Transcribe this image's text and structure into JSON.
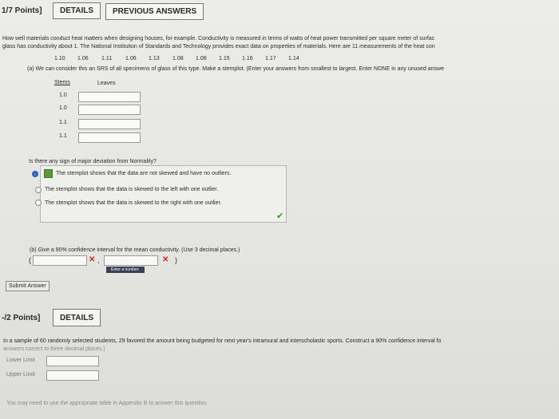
{
  "q1": {
    "points": "1/7 Points]",
    "details_button": "DETAILS",
    "previous_answers_button": "PREVIOUS ANSWERS",
    "intro_line1": "How well materials conduct heat matters when designing houses, for example. Conductivity is measured in terms of watts of heat power transmitted per square meter of surfac",
    "intro_line2": "glass has conductivity about 1. The National Institution of Standards and Technology provides exact data on properties of materials. Here are 11 measurements of the heat con",
    "measurements": [
      "1.10",
      "1.06",
      "1.11",
      "1.06",
      "1.13",
      "1.08",
      "1.08",
      "1.15",
      "1.16",
      "1.17",
      "1.14"
    ],
    "part_a": "(a) We can consider this an SRS of all specimens of glass of this type. Make a stemplot. (Enter your answers from smallest to largest. Enter NONE in any unused answe",
    "stems_header": "Stems",
    "leaves_header": "Leaves",
    "stems": [
      "1.0",
      "1.0",
      "1.1",
      "1.1"
    ],
    "normality_question": "Is there any sign of major deviation from Normality?",
    "options": [
      "The stemplot shows that the data are not skewed and have no outliers.",
      "The stemplot shows that the data is skewed to the left with one outlier.",
      "The stemplot shows that the data is skewed to the right with one outlier."
    ],
    "part_b": "(b) Give a 90% confidence interval for the mean conductivity. (Use 3 decimal places.)",
    "paren_open": "(",
    "paren_close": ")",
    "tooltip": "Enter a number.",
    "submit_button": "Submit Answer"
  },
  "q2": {
    "points": "-/2 Points]",
    "details_button": "DETAILS",
    "text_line1": "In a sample of 60 randomly selected students, 29 favored the amount being budgeted for next year's intramural and interscholastic sports. Construct a 90% confidence interval fo",
    "text_line2": "answers correct to three decimal places.)",
    "lower_label": "Lower Limit",
    "upper_label": "Upper Limit",
    "footer": "You may need to use the appropriate table in Appendix B to answer this question."
  },
  "colors": {
    "selected_radio": "#3d6fc9",
    "check": "#2d9a2d",
    "error": "#d02828"
  }
}
